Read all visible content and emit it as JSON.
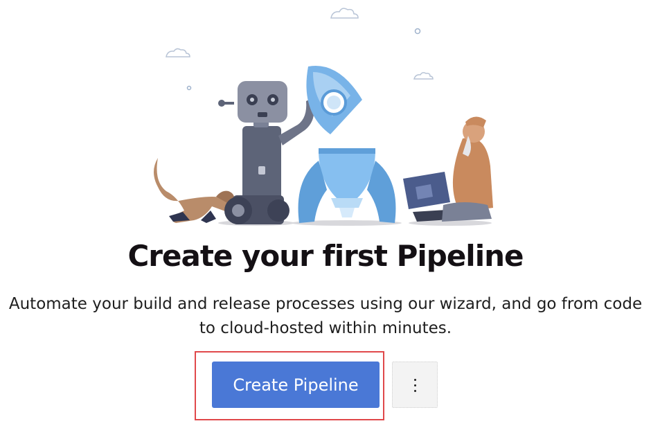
{
  "empty_state": {
    "title": "Create your first Pipeline",
    "description": "Automate your build and release processes using our wizard, and go from code to cloud-hosted within minutes.",
    "illustration_icon": "robot-rocket-dog-developer-illustration"
  },
  "actions": {
    "create_pipeline_label": "Create Pipeline",
    "more_actions_icon": "more-vertical-icon"
  },
  "colors": {
    "primary_button": "#4a78d6",
    "highlight_border": "#e0484a",
    "title_text": "#141014"
  }
}
